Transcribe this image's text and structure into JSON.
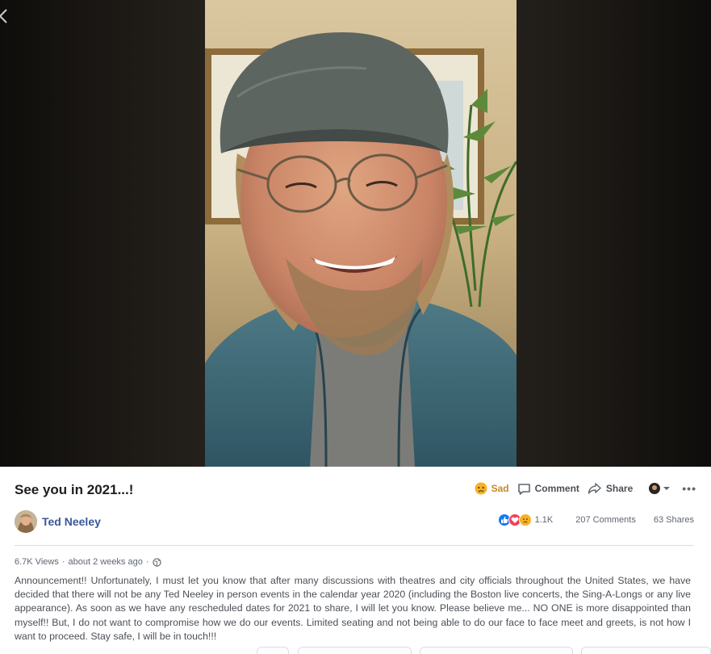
{
  "post": {
    "title": "See you in 2021...!",
    "author": "Ted Neeley",
    "views": "6.7K Views",
    "time": "about 2 weeks ago",
    "description": "Announcement!! Unfortunately, I must let you know that after many discussions with theatres and city officials throughout the United States, we have decided that there will not be any Ted Neeley in person events in the calendar year 2020 (including the Boston live concerts, the Sing-A-Longs or any live appearance). As soon as we have any rescheduled dates for 2021 to share, I will let you know. Please believe me... NO ONE is more disappointed than myself!! But, I do not want to compromise how we do our events. Limited seating and not being able to do our face to face meet and greets, is not how I want to proceed. Stay safe, I will be in touch!!!"
  },
  "actions": {
    "reaction_label": "Sad",
    "comment_label": "Comment",
    "share_label": "Share",
    "more_label": "•••"
  },
  "stats": {
    "reactions_count": "1.1K",
    "comments": "207 Comments",
    "shares": "63 Shares"
  },
  "icons": {
    "back": "chevron-left-icon",
    "sad": "sad-emoji-icon",
    "comment": "comment-bubble-icon",
    "share": "share-arrow-icon",
    "like": "like-reaction-icon",
    "love": "love-reaction-icon",
    "globe": "globe-icon",
    "more": "more-dots-icon"
  },
  "colors": {
    "link_blue": "#385898",
    "like_blue": "#1877f2",
    "love_red": "#f33e58",
    "sad_yellow": "#f7b125",
    "muted_text": "#606770"
  }
}
